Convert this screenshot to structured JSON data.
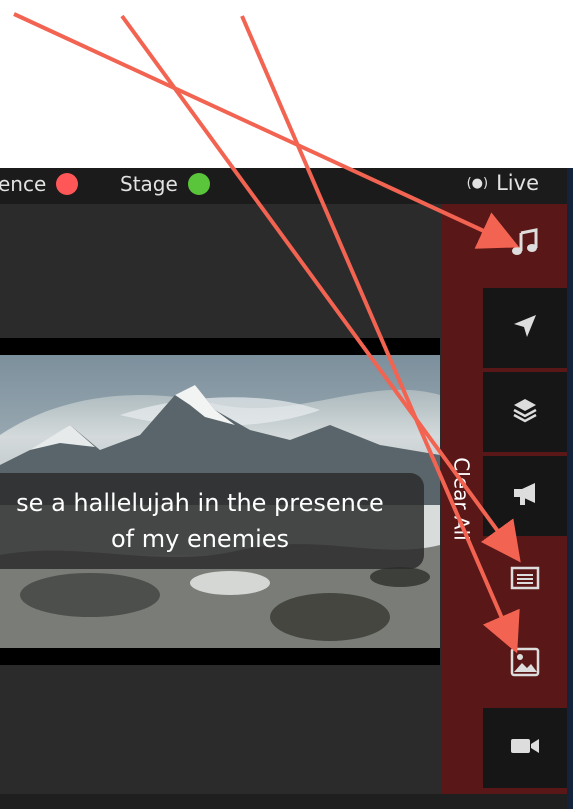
{
  "status_bar": {
    "audience_label": "ence",
    "audience_color": "#ff5757",
    "stage_label": "Stage",
    "stage_color": "#5ac53a",
    "live_label": "Live",
    "live_icon": "broadcast-icon"
  },
  "preview": {
    "lyric_line_1": "se a hallelujah in the presence",
    "lyric_line_2": "of my enemies"
  },
  "clear_panel": {
    "label": "Clear All",
    "buttons": [
      {
        "icon": "music-note-icon",
        "name": "clear-audio-button"
      },
      {
        "icon": "send-arrow-icon",
        "name": "clear-messages-button"
      },
      {
        "icon": "layers-icon",
        "name": "clear-props-button"
      },
      {
        "icon": "megaphone-icon",
        "name": "clear-announcements-button"
      },
      {
        "icon": "slide-text-icon",
        "name": "clear-slide-button"
      },
      {
        "icon": "image-icon",
        "name": "clear-media-button"
      },
      {
        "icon": "video-camera-icon",
        "name": "clear-live-video-button"
      }
    ]
  },
  "colors": {
    "panel_red": "#5a1717",
    "annotation_arrow": "#f26451"
  }
}
